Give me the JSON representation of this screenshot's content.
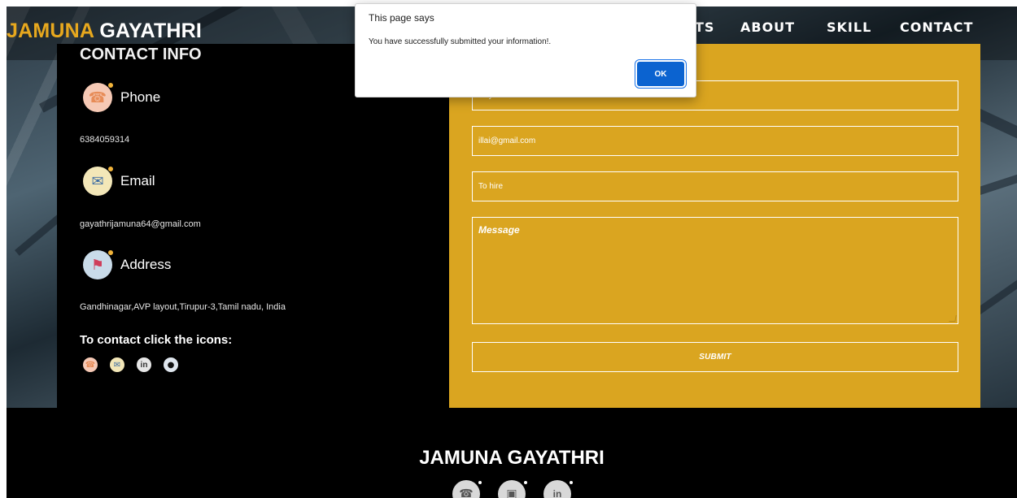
{
  "nav": {
    "brand_accent": "JAMUNA",
    "brand_rest": " GAYATHRI",
    "links": [
      {
        "label": "TS"
      },
      {
        "label": "ABOUT"
      },
      {
        "label": "SKILL"
      },
      {
        "label": "CONTACT"
      }
    ]
  },
  "contact": {
    "title": "CONTACT INFO",
    "phone_label": "Phone",
    "phone_value": "6384059314",
    "email_label": "Email",
    "email_value": "gayathrijamuna64@gmail.com",
    "address_label": "Address",
    "address_value": "Gandhinagar,AVP layout,Tirupur-3,Tamil nadu, India",
    "icons_prompt": "To contact click the icons:",
    "icons": [
      "phone-icon",
      "mail-icon",
      "linkedin-icon",
      "github-icon"
    ]
  },
  "form": {
    "name_value": "Illaya",
    "email_value": "illai@gmail.com",
    "subject_value": "To hire",
    "message_placeholder": "Message",
    "submit_label": "SUBMIT"
  },
  "dialog": {
    "title": "This page says",
    "message": "You have successfully submitted your information!.",
    "ok_label": "OK"
  },
  "footer": {
    "name": "JAMUNA GAYATHRI",
    "socials": [
      "phone-icon",
      "instagram-icon",
      "linkedin-icon"
    ]
  },
  "colors": {
    "accent": "#daa520",
    "brand_accent": "#e7a81e",
    "panel": "#000000",
    "ok_button": "#0b63d0"
  }
}
